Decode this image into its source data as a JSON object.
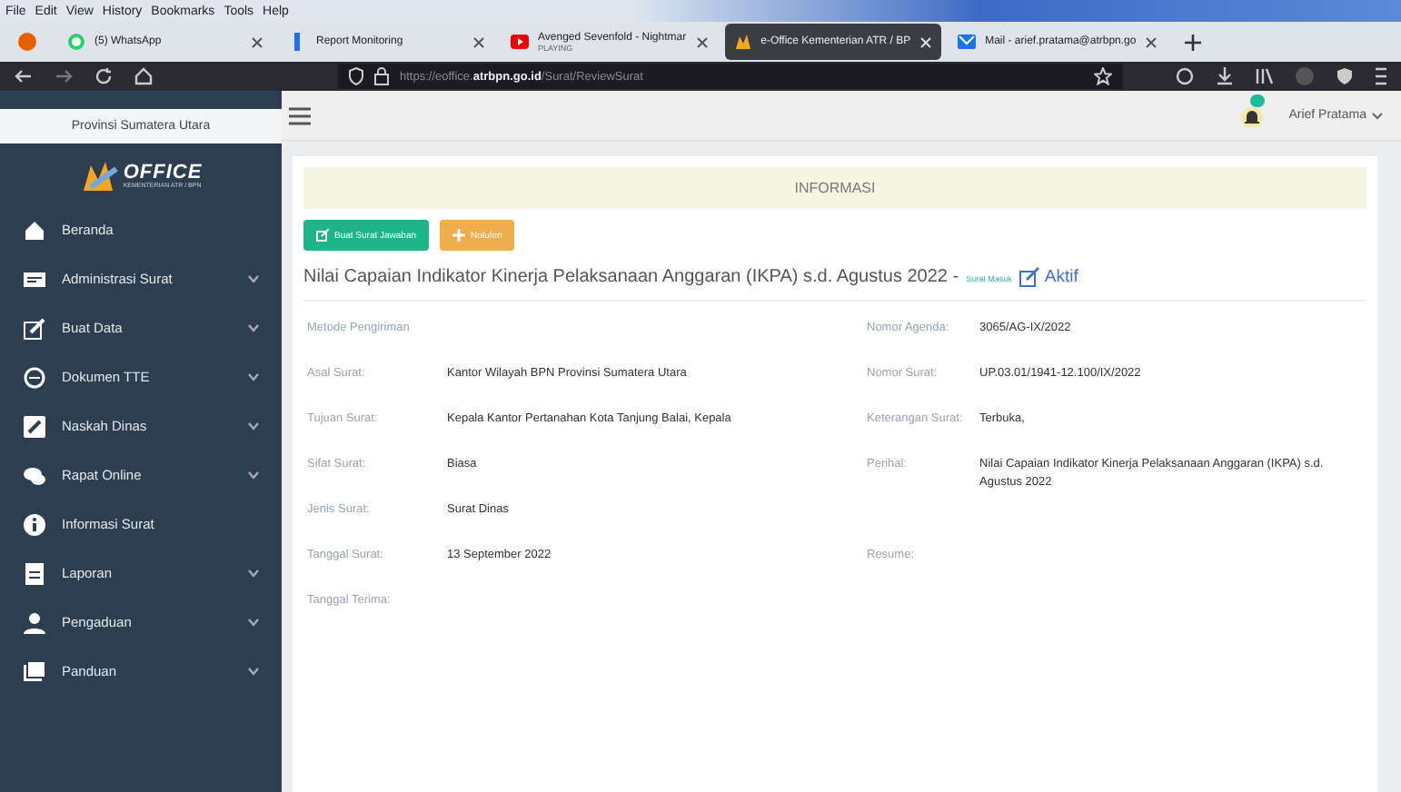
{
  "menu_bar": [
    "File",
    "Edit",
    "View",
    "History",
    "Bookmarks",
    "Tools",
    "Help"
  ],
  "tabs": [
    {
      "label": "(5) WhatsApp",
      "selected": false
    },
    {
      "label": "Report Monitoring",
      "selected": false
    },
    {
      "label": "Avenged Sevenfold - Nightmar",
      "sublabel": "PLAYING",
      "selected": false
    },
    {
      "label": "e-Office Kementerian ATR / BP",
      "selected": true
    },
    {
      "label": "Mail - arief.pratama@atrbpn.go",
      "selected": false
    }
  ],
  "address_bar": {
    "value_prefix": "https://eoffice.",
    "value_domain": "atrbpn.go.id",
    "value_path": "/Surat/ReviewSurat"
  },
  "sidebar": {
    "region": "Provinsi Sumatera Utara",
    "logo": "OFFICE",
    "logo_sub": "KEMENTERIAN ATR / BPN",
    "items": [
      {
        "label": "Beranda",
        "expandable": false
      },
      {
        "label": "Administrasi Surat",
        "expandable": true
      },
      {
        "label": "Buat Data",
        "expandable": true
      },
      {
        "label": "Dokumen TTE",
        "expandable": true
      },
      {
        "label": "Naskah Dinas",
        "expandable": true
      },
      {
        "label": "Rapat Online",
        "expandable": true
      },
      {
        "label": "Informasi Surat",
        "expandable": false
      },
      {
        "label": "Laporan",
        "expandable": true
      },
      {
        "label": "Pengaduan",
        "expandable": true
      },
      {
        "label": "Panduan",
        "expandable": true
      }
    ]
  },
  "header": {
    "user": "Arief Pratama"
  },
  "panel": {
    "title": "INFORMASI",
    "buttons": [
      {
        "label": "Buat Surat Jawaban",
        "kind": "primary"
      },
      {
        "label": "Notulen",
        "kind": "warning"
      }
    ],
    "subject": "Nilai Capaian Indikator Kinerja Pelaksanaan Anggaran (IKPA) s.d. Agustus 2022 -",
    "subject_tag": "Surat Masuk",
    "status": "Aktif",
    "left_fields": [
      {
        "label": "Metode Pengiriman"
      },
      {
        "label": "Asal Surat:",
        "value": "Kantor Wilayah BPN Provinsi Sumatera Utara"
      },
      {
        "label": "Tujuan Surat:",
        "value": "Kepala Kantor Pertanahan Kota Tanjung Balai, Kepala"
      },
      {
        "label": "Sifat Surat:",
        "value": "Biasa"
      },
      {
        "label": "Jenis Surat:",
        "value": "Surat Dinas"
      },
      {
        "label": "Tanggal Surat:",
        "value": "13 September 2022"
      },
      {
        "label": "Tanggal Terima:"
      }
    ],
    "right_fields": [
      {
        "label": "Nomor Agenda:",
        "value": "3065/AG-IX/2022"
      },
      {
        "label": "Nomor Surat:",
        "value": "UP.03.01/1941-12.100/IX/2022"
      },
      {
        "label": "Keterangan Surat:",
        "value": "Terbuka,"
      },
      {
        "label": "Perihal:",
        "value": "Nilai Capaian Indikator Kinerja Pelaksanaan Anggaran (IKPA) s.d. Agustus 2022"
      },
      {
        "label": "Resume:"
      }
    ]
  }
}
